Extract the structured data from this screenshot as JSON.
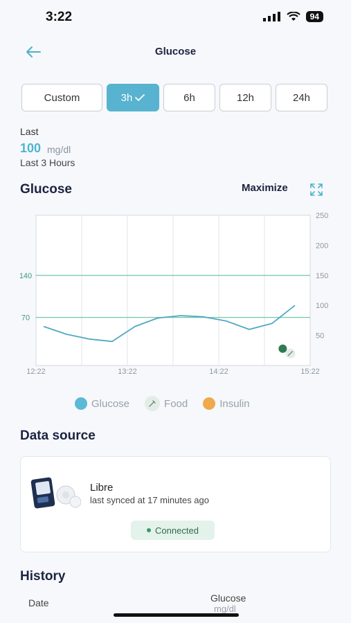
{
  "status_bar": {
    "time": "3:22",
    "battery": "94"
  },
  "header": {
    "title": "Glucose"
  },
  "tabs": [
    {
      "label": "Custom",
      "active": false
    },
    {
      "label": "3h",
      "active": true
    },
    {
      "label": "6h",
      "active": false
    },
    {
      "label": "12h",
      "active": false
    },
    {
      "label": "24h",
      "active": false
    }
  ],
  "last_reading": {
    "label": "Last",
    "value": "100",
    "unit": "mg/dl",
    "period": "Last 3 Hours"
  },
  "chart_section": {
    "title": "Glucose",
    "maximize_label": "Maximize"
  },
  "chart_data": {
    "type": "line",
    "x_ticks": [
      "12:22",
      "13:22",
      "14:22",
      "15:22"
    ],
    "y_ticks_right": [
      50,
      100,
      150,
      200,
      250
    ],
    "reference_lines": [
      {
        "label": "140",
        "value": 150
      },
      {
        "label": "70",
        "value": 80
      }
    ],
    "ylim": [
      0,
      250
    ],
    "xlim_minutes": [
      0,
      180
    ],
    "series": [
      {
        "name": "Glucose",
        "color": "#4fa8c4",
        "points": [
          [
            5,
            65
          ],
          [
            20,
            52
          ],
          [
            35,
            44
          ],
          [
            50,
            40
          ],
          [
            65,
            65
          ],
          [
            80,
            79
          ],
          [
            95,
            83
          ],
          [
            110,
            81
          ],
          [
            125,
            74
          ],
          [
            140,
            60
          ],
          [
            155,
            70
          ],
          [
            170,
            100
          ]
        ]
      }
    ],
    "markers": [
      {
        "type": "glucose-reading",
        "x": 162,
        "y": 28,
        "color": "#2f7a52"
      },
      {
        "type": "food",
        "x": 167,
        "y": 20,
        "color": "#e4ece8"
      }
    ],
    "grid": true
  },
  "legend": [
    {
      "label": "Glucose",
      "color": "#5bb8d6",
      "icon": "dot"
    },
    {
      "label": "Food",
      "color": "#e4ece8",
      "icon": "fork-icon"
    },
    {
      "label": "Insulin",
      "color": "#eeaa4c",
      "icon": "dot"
    }
  ],
  "data_source": {
    "title": "Data source",
    "device_name": "Libre",
    "sync_text": "last synced at  17 minutes  ago",
    "status": "Connected"
  },
  "history": {
    "title": "History",
    "col_date": "Date",
    "col_glucose": "Glucose",
    "col_unit": "mg/dl"
  }
}
